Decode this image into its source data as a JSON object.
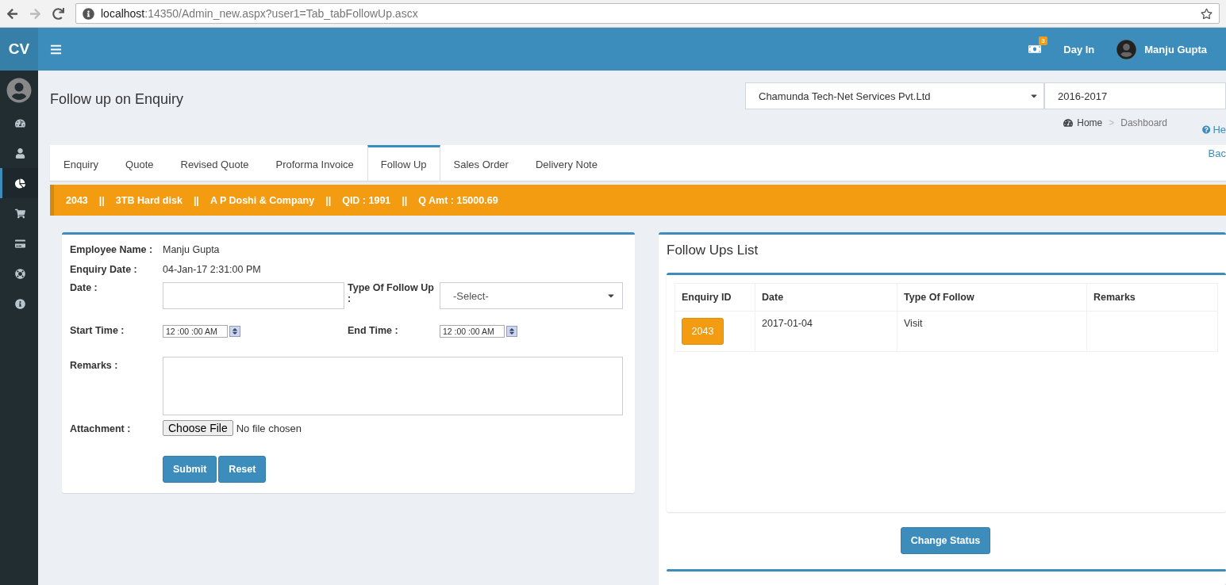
{
  "browser": {
    "url_host": "localhost",
    "url_path": ":14350/Admin_new.aspx?user1=Tab_tabFollowUp.ascx"
  },
  "header": {
    "logo": "CV",
    "notification_count": "3",
    "day_in": "Day In",
    "user_name": "Manju Gupta"
  },
  "sidebar": {
    "items": [
      {
        "selected": false
      },
      {
        "selected": false
      },
      {
        "selected": true
      },
      {
        "selected": false
      },
      {
        "selected": false
      },
      {
        "selected": false
      },
      {
        "selected": false
      }
    ]
  },
  "page": {
    "title": "Follow up on Enquiry",
    "company": "Chamunda Tech-Net Services Pvt.Ltd",
    "year": "2016-2017",
    "breadcrumb": [
      "Home",
      "Dashboard"
    ],
    "breadcrumb_separator": ">",
    "help": "He",
    "back": "Bac"
  },
  "tabs": [
    {
      "label": "Enquiry",
      "selected": false
    },
    {
      "label": "Quote",
      "selected": false
    },
    {
      "label": "Revised Quote",
      "selected": false
    },
    {
      "label": "Proforma Invoice",
      "selected": false
    },
    {
      "label": "Follow Up",
      "selected": true
    },
    {
      "label": "Sales Order",
      "selected": false
    },
    {
      "label": "Delivery Note",
      "selected": false
    }
  ],
  "summary": [
    "2043",
    "3TB Hard disk",
    "A P Doshi & Company",
    "QID : 1991",
    "Q Amt : 15000.69"
  ],
  "summary_separator": "||",
  "form": {
    "employee_label": "Employee Name :",
    "employee": "Manju Gupta",
    "enquiry_date_label": "Enquiry Date :",
    "enquiry_date": "04-Jan-17 2:31:00 PM",
    "date_label": "Date :",
    "type_label": "Type Of Follow Up :",
    "type_placeholder": "-Select-",
    "start_label": "Start Time :",
    "start_time": "12 :00 :00 AM",
    "end_label": "End Time :",
    "end_time": "12 :00 :00 AM",
    "remarks_label": "Remarks :",
    "attachment_label": "Attachment :",
    "choose_file": "Choose File",
    "no_file": "No file chosen",
    "submit": "Submit",
    "reset": "Reset"
  },
  "follow_ups": {
    "title": "Follow Ups List",
    "columns": [
      "Enquiry ID",
      "Date",
      "Type Of Follow",
      "Remarks"
    ],
    "rows": [
      {
        "enquiry_id": "2043",
        "date": "2017-01-04",
        "type": "Visit"
      }
    ],
    "change_status": "Change Status"
  }
}
